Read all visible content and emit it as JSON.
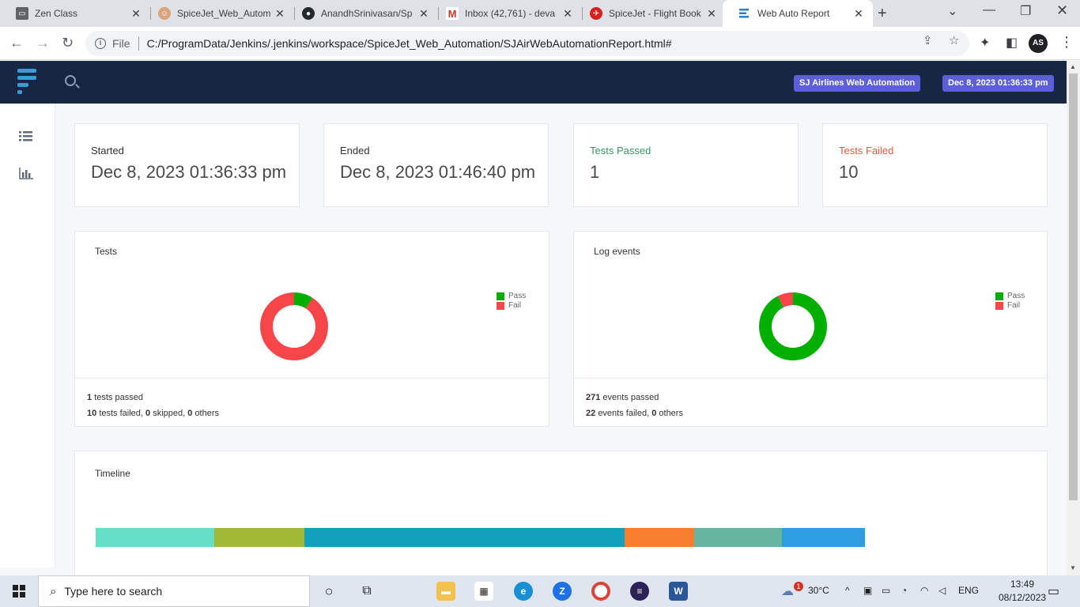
{
  "browser": {
    "tabs": [
      {
        "title": "Zen Class",
        "favicon": "zen-icon",
        "active": false
      },
      {
        "title": "SpiceJet_Web_Autom",
        "favicon": "jenkins-icon",
        "active": false
      },
      {
        "title": "AnandhSrinivasan/Sp",
        "favicon": "github-icon",
        "active": false
      },
      {
        "title": "Inbox (42,761) - deva",
        "favicon": "gmail-icon",
        "active": false
      },
      {
        "title": "SpiceJet - Flight Book",
        "favicon": "spicejet-icon",
        "active": false
      },
      {
        "title": "Web Auto Report",
        "favicon": "report-icon",
        "active": true
      }
    ],
    "address": {
      "scheme_label": "File",
      "url": "C:/ProgramData/Jenkins/.jenkins/workspace/SpiceJet_Web_Automation/SJAirWebAutomationReport.html#"
    }
  },
  "header": {
    "report_name": "SJ Airlines Web Automation",
    "report_time": "Dec 8, 2023 01:36:33 pm"
  },
  "stats": {
    "started_label": "Started",
    "started_value": "Dec 8, 2023 01:36:33 pm",
    "ended_label": "Ended",
    "ended_value": "Dec 8, 2023 01:46:40 pm",
    "passed_label": "Tests Passed",
    "passed_value": "1",
    "failed_label": "Tests Failed",
    "failed_value": "10"
  },
  "colors": {
    "pass": "#00af00",
    "fail": "#f7464a",
    "passed_label": "#339966",
    "failed_label": "#e9573f"
  },
  "tests_card": {
    "title": "Tests",
    "legend_pass": "Pass",
    "legend_fail": "Fail",
    "passed_count": "1",
    "passed_text": "tests passed",
    "failed_count": "10",
    "failed_text": "tests failed,",
    "skipped_count": "0",
    "skipped_text": "skipped,",
    "others_count": "0",
    "others_text": "others"
  },
  "log_card": {
    "title": "Log events",
    "legend_pass": "Pass",
    "legend_fail": "Fail",
    "passed_count": "271",
    "passed_text": "events passed",
    "failed_count": "22",
    "failed_text": "events failed,",
    "others_count": "0",
    "others_text": "others"
  },
  "chart_data": [
    {
      "type": "pie",
      "title": "Tests",
      "categories": [
        "Pass",
        "Fail"
      ],
      "values": [
        1,
        10
      ],
      "legend": "top-right"
    },
    {
      "type": "pie",
      "title": "Log events",
      "categories": [
        "Pass",
        "Fail"
      ],
      "values": [
        271,
        22
      ],
      "legend": "top-right"
    }
  ],
  "timeline": {
    "title": "Timeline",
    "segments": [
      {
        "share": 0.1533,
        "color": "#67dfc8"
      },
      {
        "share": 0.1162,
        "color": "#a0b836"
      },
      {
        "share": 0.4122,
        "color": "#13a0bd"
      },
      {
        "share": 0.0899,
        "color": "#f87d2e"
      },
      {
        "share": 0.1132,
        "color": "#65b5a0"
      },
      {
        "share": 0.1071,
        "color": "#2e9ee1"
      }
    ]
  },
  "taskbar": {
    "search_placeholder": "Type here to search",
    "weather_temp": "30°C",
    "weather_alert_count": "1",
    "language": "ENG",
    "time": "13:49",
    "date": "08/12/2023"
  }
}
